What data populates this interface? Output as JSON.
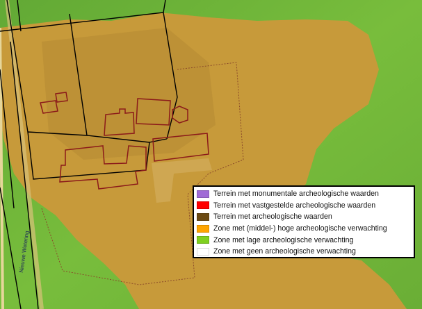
{
  "map": {
    "colors": {
      "low_expectation": "#74b83c",
      "medium_high_expectation": "#c79a3a",
      "no_expectation": "#ffffff",
      "monument": "#a06bd6",
      "established": "#ff0000",
      "archaeological": "#6b4a12",
      "parcel_lines": "#000000",
      "building_outline": "#8b1a1a"
    },
    "street_label": "Nieuwe Wetering"
  },
  "legend": {
    "items": [
      {
        "label": "Terrein met monumentale archeologische waarden",
        "color": "#a06bd6"
      },
      {
        "label": "Terrein met vastgestelde archeologische waarden",
        "color": "#ff0000"
      },
      {
        "label": "Terrein met archeologische waarden",
        "color": "#6b4a12"
      },
      {
        "label": "Zone met (middel-) hoge archeologische verwachting",
        "color": "#ffa500"
      },
      {
        "label": "Zone met lage archeologische verwachting",
        "color": "#80d020"
      },
      {
        "label": "Zone met geen archeologische verwachting",
        "color": "#ffffff"
      }
    ]
  }
}
